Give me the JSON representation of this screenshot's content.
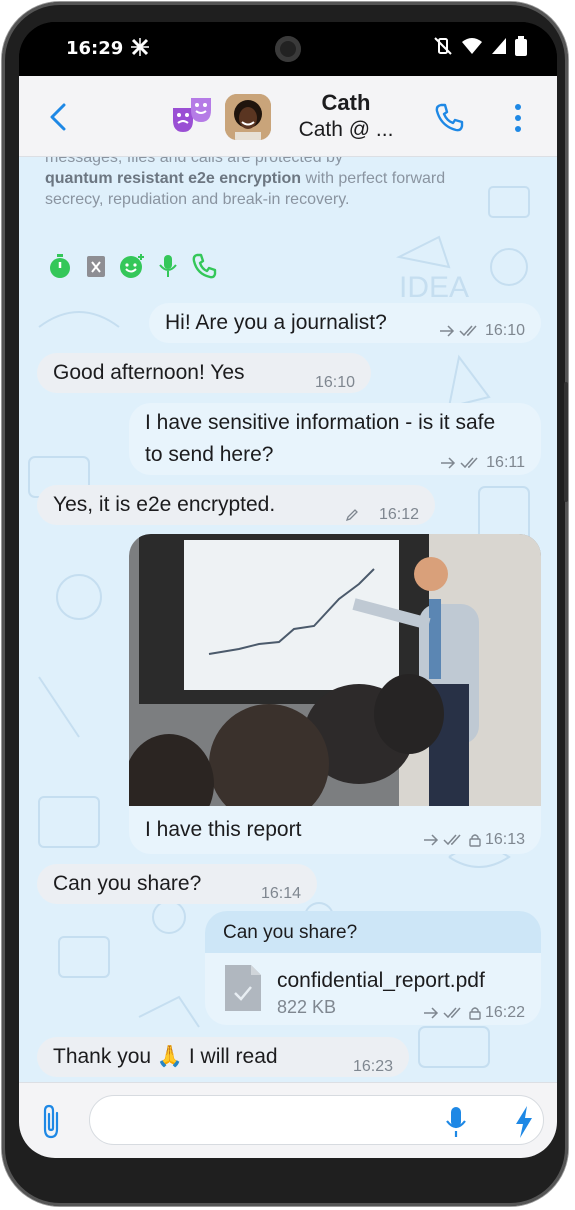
{
  "status": {
    "time": "16:29"
  },
  "contact": {
    "name": "Cath",
    "subtitle": "Cath @ ..."
  },
  "info_text": {
    "line1": "messages, files and calls are protected by",
    "bold": "quantum resistant e2e encryption",
    "rest": " with perfect forward secrecy, repudiation and break-in recovery."
  },
  "messages": [
    {
      "dir": "out",
      "text": "Hi! Are you a journalist?",
      "time": "16:10"
    },
    {
      "dir": "in",
      "text": "Good afternoon! Yes",
      "time": "16:10"
    },
    {
      "dir": "out",
      "text": "I have sensitive information - is it safe to send here?",
      "time": "16:11"
    },
    {
      "dir": "in",
      "text": "Yes, it is e2e encrypted.",
      "time": "16:12"
    },
    {
      "dir": "out",
      "text": "I have this report",
      "time": "16:13",
      "image": "presentation-photo"
    },
    {
      "dir": "in",
      "text": "Can you share?",
      "time": "16:14"
    },
    {
      "dir": "out",
      "quote": "Can you share?",
      "file_name": "confidential_report.pdf",
      "file_size": "822 KB",
      "time": "16:22"
    },
    {
      "dir": "in",
      "text": "Thank you 🙏 I will read",
      "time": "16:23"
    }
  ],
  "composer": {
    "placeholder": ""
  },
  "colors": {
    "accent": "#1e88e5",
    "feature_green": "#34c759",
    "outgoing_bubble": "#e8f4fc",
    "incoming_bubble": "#eceff3",
    "chat_bg": "#dff0fb"
  }
}
